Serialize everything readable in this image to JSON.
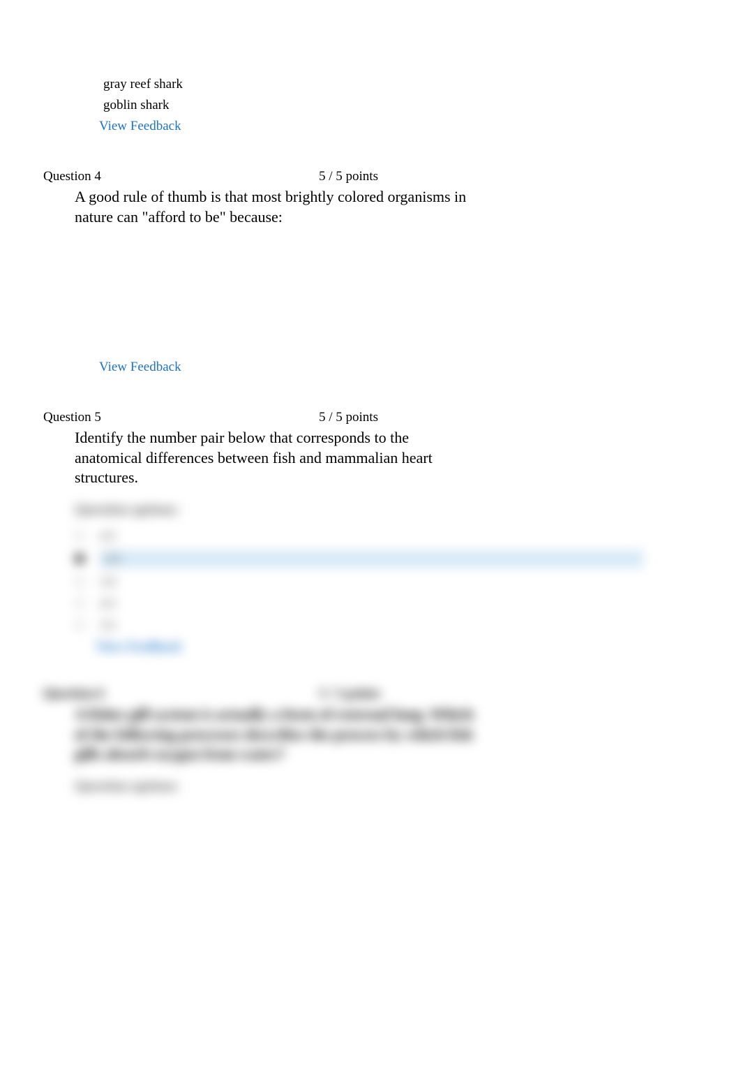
{
  "question3": {
    "options": [
      "gray reef shark",
      "goblin shark"
    ],
    "feedback_link": "View Feedback"
  },
  "question4": {
    "label": "Question 4",
    "points": "5 / 5 points",
    "text": "A good rule of thumb is that most brightly colored organisms in nature can \"afford to be\" because:",
    "feedback_link": "View Feedback"
  },
  "question5": {
    "label": "Question 5",
    "points": "5 / 5 points",
    "text": "Identify the number pair below that corresponds to the anatomical differences between fish and mammalian heart structures.",
    "options_label": "Question options:",
    "options": [
      "4/2",
      "2/4",
      "3/4",
      "4/3",
      "3/2"
    ],
    "selected_index": 1,
    "feedback_link": "View Feedback"
  },
  "question6": {
    "label": "Question 6",
    "points": "5 / 5 points",
    "text": "A fishes gill system is actually a form of external lung. Which of the following processes describes the process by which fish gills absorb oxygen from water?",
    "options_label": "Question options:"
  }
}
